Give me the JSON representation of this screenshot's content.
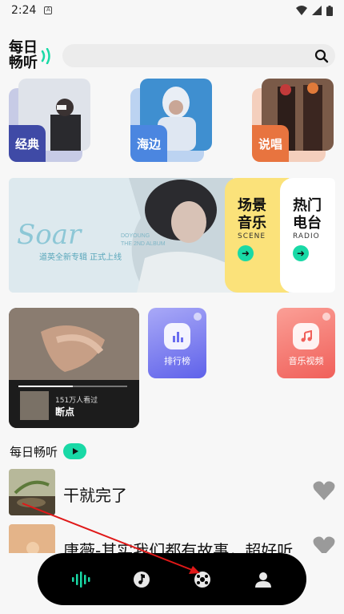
{
  "status": {
    "time": "2:24"
  },
  "header": {
    "logo_line1": "每日",
    "logo_line2": "畅听",
    "search_placeholder": ""
  },
  "categories": [
    {
      "label": "经典",
      "color": "#3f4aa6"
    },
    {
      "label": "海边",
      "color": "#4b86e0"
    },
    {
      "label": "说唱",
      "color": "#e8743f"
    }
  ],
  "banner": {
    "script_title": "Soar",
    "subtitle_en1": "DOYOUNG",
    "subtitle_en2": "THE 2ND ALBUM",
    "caption": "道英全新专辑 正式上线",
    "tiles": [
      {
        "line1": "场景",
        "line2": "音乐",
        "tag": "SCENE",
        "color": "#fbe27a"
      },
      {
        "line1": "热门",
        "line2": "电台",
        "tag": "RADIO",
        "color": "#ffffff"
      }
    ]
  },
  "featured": {
    "plays": "151万人看过",
    "title": "断点",
    "progress": 0.5
  },
  "shortcuts": [
    {
      "label": "排行榜",
      "icon": "bar-chart-icon",
      "color": "#7b7ff0"
    },
    {
      "label": "音乐视频",
      "icon": "music-note-icon",
      "color": "#f57a72"
    }
  ],
  "daily": {
    "title": "每日畅听",
    "songs": [
      {
        "name": "干就完了"
      },
      {
        "name": "唐薇-其实我们都有故事，超好听"
      }
    ]
  },
  "nav": {
    "items": [
      "waveform-icon",
      "music-note-icon",
      "disc-icon",
      "profile-icon"
    ],
    "active": 0,
    "accent": "#19d9a6"
  }
}
